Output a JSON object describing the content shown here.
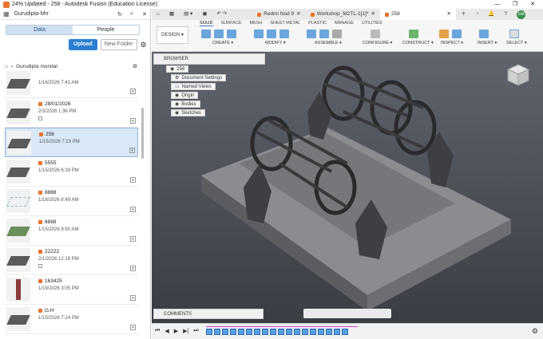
{
  "window": {
    "title": "24% Updated - 258 - Autodesk Fusion (Education License)",
    "controls": [
      "—",
      "❐",
      "✕"
    ]
  },
  "left_panel": {
    "team": "Gurudipta-Mrr",
    "tabs": [
      {
        "label": "Data",
        "active": true
      },
      {
        "label": "People",
        "active": false
      }
    ],
    "upload_label": "Upload",
    "new_folder_label": "New Folder",
    "breadcrumb": "Gurudipta mondal",
    "files": [
      {
        "name": "",
        "date": "1/16/2026 7:41 AM",
        "selected": false
      },
      {
        "name": "28/01/2026",
        "date": "2/3/2026 1:36 PM",
        "selected": false
      },
      {
        "name": "258",
        "date": "1/15/2026 7:23 PM",
        "selected": true
      },
      {
        "name": "5555",
        "date": "1/15/2026 6:39 PM",
        "selected": false
      },
      {
        "name": "8888",
        "date": "1/18/2026 8:49 AM",
        "selected": false
      },
      {
        "name": "8888",
        "date": "1/15/2026 9:50 AM",
        "selected": false
      },
      {
        "name": "22222",
        "date": "2/1/2026 12:18 PM",
        "selected": false
      },
      {
        "name": "163425",
        "date": "1/19/2026 3:05 PM",
        "selected": false
      },
      {
        "name": "G.H",
        "date": "1/15/2026 7:24 PM",
        "selected": false
      }
    ]
  },
  "doc_tabs": [
    {
      "label": "Redmi Nod 9",
      "active": false
    },
    {
      "label": "Workshop_M2TL-1[1]*",
      "active": false
    },
    {
      "label": "258",
      "active": true
    }
  ],
  "ribbon": {
    "workspace": "DESIGN ▾",
    "tabs": [
      "SOLID",
      "SURFACE",
      "MESH",
      "SHEET METAL",
      "PLASTIC",
      "MANAGE",
      "UTILITIES"
    ],
    "groups": [
      "CREATE ▾",
      "MODIFY ▾",
      "ASSEMBLE ▾",
      "CONFIGURE ▾",
      "CONSTRUCT ▾",
      "INSPECT ▾",
      "INSERT ▾",
      "SELECT ▾"
    ]
  },
  "browser": {
    "title": "BROWSER",
    "root": "258",
    "nodes": [
      "Document Settings",
      "Named Views",
      "Origin",
      "Bodies",
      "Sketches"
    ]
  },
  "comments_label": "COMMENTS",
  "user_initials": "GM"
}
